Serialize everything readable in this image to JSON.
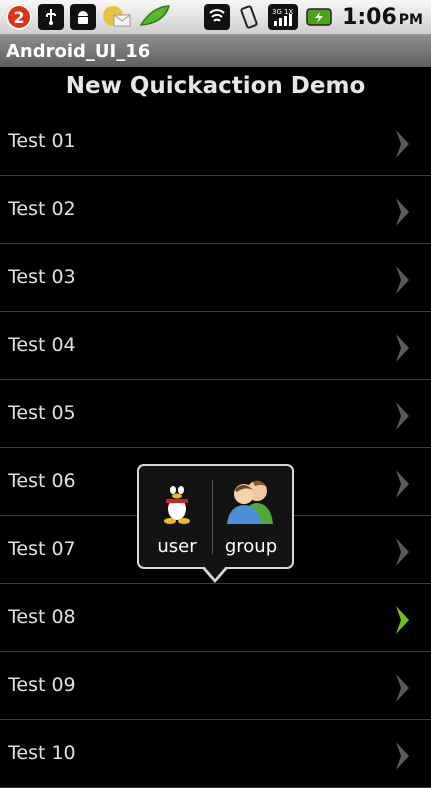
{
  "status_bar": {
    "notification_count": "2",
    "time": "1:06",
    "ampm": "PM",
    "icons": [
      "usb-icon",
      "android-debug-icon",
      "email-icon",
      "peas-icon",
      "wifi-icon",
      "vibrate-icon",
      "signal-3g-icon",
      "battery-charging-icon"
    ]
  },
  "app_title": "Android_UI_16",
  "screen_heading": "New Quickaction Demo",
  "list_items": [
    {
      "label": "Test 01",
      "active": false
    },
    {
      "label": "Test 02",
      "active": false
    },
    {
      "label": "Test 03",
      "active": false
    },
    {
      "label": "Test 04",
      "active": false
    },
    {
      "label": "Test 05",
      "active": false
    },
    {
      "label": "Test 06",
      "active": false
    },
    {
      "label": "Test 07",
      "active": false
    },
    {
      "label": "Test 08",
      "active": true
    },
    {
      "label": "Test 09",
      "active": false
    },
    {
      "label": "Test 10",
      "active": false
    }
  ],
  "quick_action": {
    "items": [
      {
        "label": "user",
        "icon": "penguin-icon"
      },
      {
        "label": "group",
        "icon": "group-icon"
      }
    ]
  },
  "colors": {
    "chevron_default": "#5a5a5a",
    "chevron_active": "#6fbf1e"
  }
}
